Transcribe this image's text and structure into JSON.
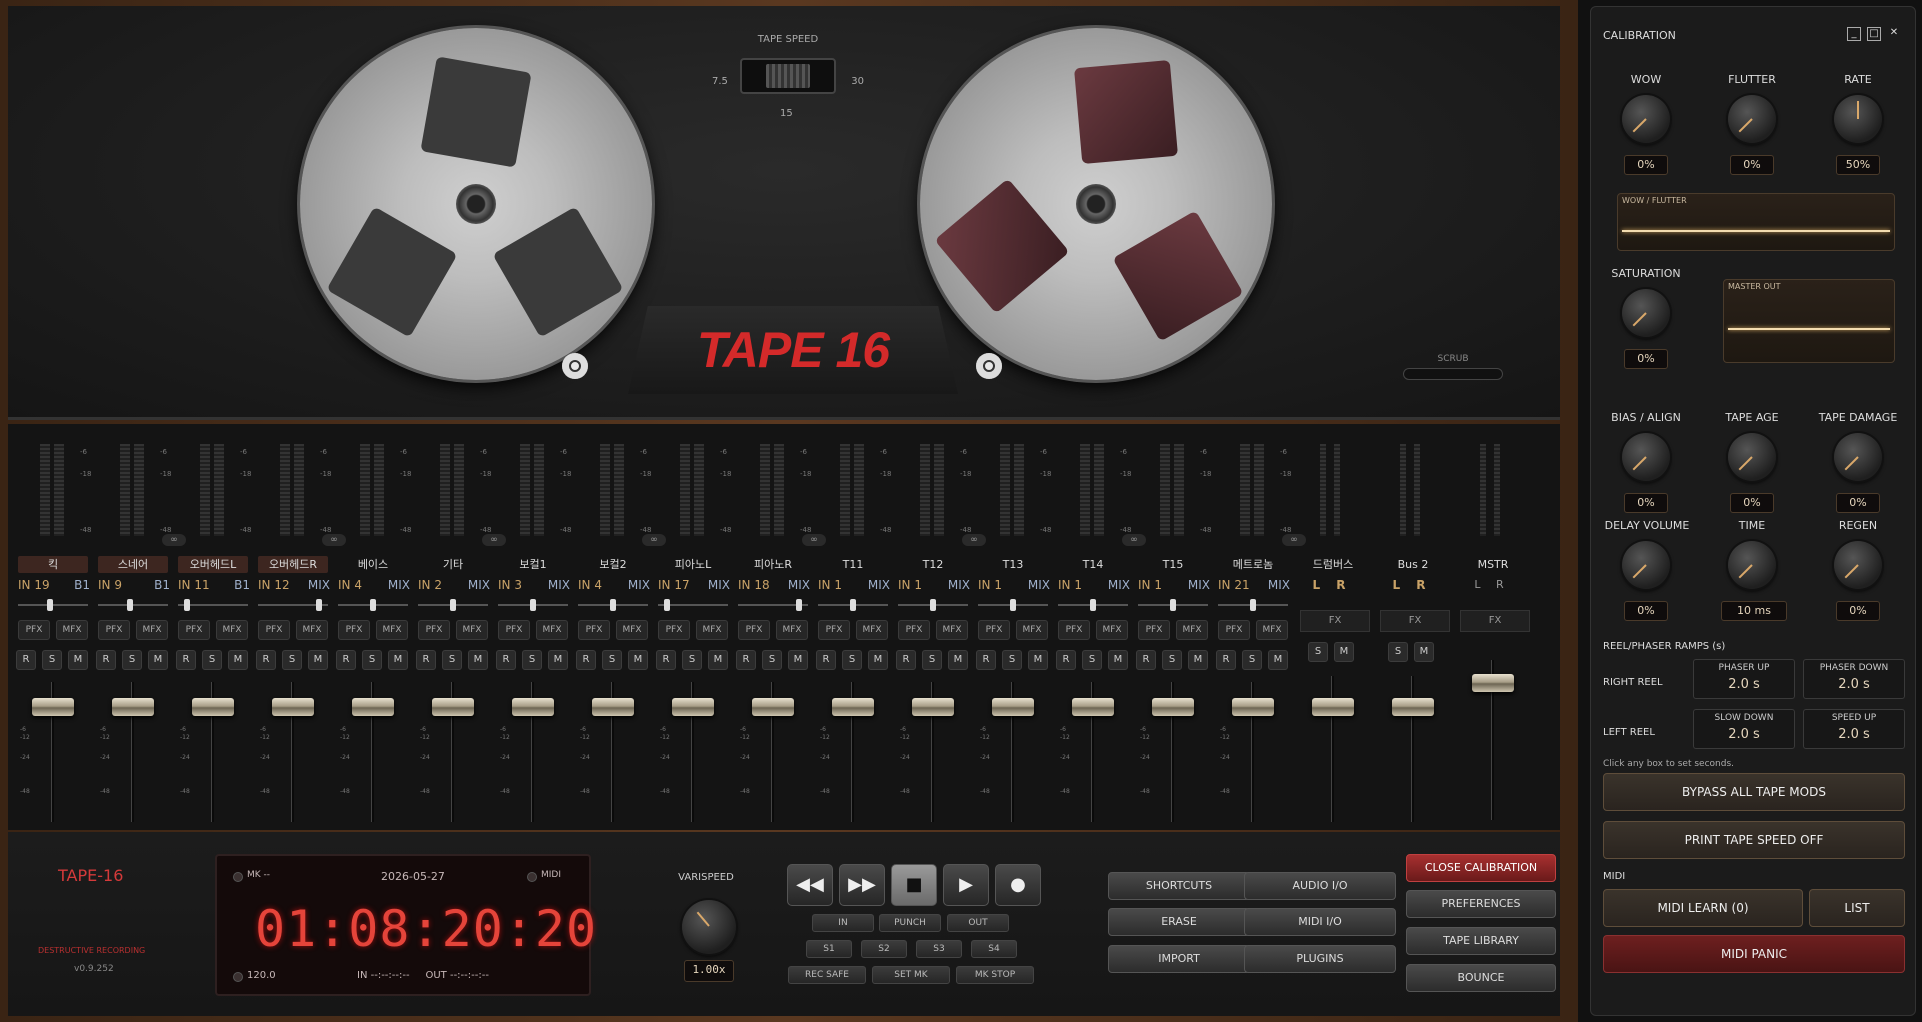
{
  "deck": {
    "logo": "TAPE 16",
    "tape_speed_label": "TAPE SPEED",
    "speed_low": "7.5",
    "speed_high": "30",
    "speed_mid": "15",
    "scrub_label": "SCRUB"
  },
  "channels": [
    {
      "name": "킥",
      "in": "IN 19",
      "route": "B1",
      "hl": true
    },
    {
      "name": "스네어",
      "in": "IN 9",
      "route": "B1",
      "hl": true
    },
    {
      "name": "오버헤드L",
      "in": "IN 11",
      "route": "B1",
      "hl": true
    },
    {
      "name": "오버헤드R",
      "in": "IN 12",
      "route": "MIX",
      "hl": true
    },
    {
      "name": "베이스",
      "in": "IN 4",
      "route": "MIX",
      "hl": false
    },
    {
      "name": "기타",
      "in": "IN 2",
      "route": "MIX",
      "hl": false
    },
    {
      "name": "보컬1",
      "in": "IN 3",
      "route": "MIX",
      "hl": false
    },
    {
      "name": "보컬2",
      "in": "IN 4",
      "route": "MIX",
      "hl": false
    },
    {
      "name": "피아노L",
      "in": "IN 17",
      "route": "MIX",
      "hl": false
    },
    {
      "name": "피아노R",
      "in": "IN 18",
      "route": "MIX",
      "hl": false
    },
    {
      "name": "T11",
      "in": "IN 1",
      "route": "MIX",
      "hl": false
    },
    {
      "name": "T12",
      "in": "IN 1",
      "route": "MIX",
      "hl": false
    },
    {
      "name": "T13",
      "in": "IN 1",
      "route": "MIX",
      "hl": false
    },
    {
      "name": "T14",
      "in": "IN 1",
      "route": "MIX",
      "hl": false
    },
    {
      "name": "T15",
      "in": "IN 1",
      "route": "MIX",
      "hl": false
    },
    {
      "name": "메트로놈",
      "in": "IN 21",
      "route": "MIX",
      "hl": false
    }
  ],
  "strip_labels": {
    "pfx": "PFX",
    "mfx": "MFX",
    "r": "R",
    "s": "S",
    "m": "M",
    "fx": "FX",
    "lr": "L R",
    "link": "∞",
    "m6": "-6",
    "m12": "-12",
    "m18": "-18",
    "m24": "-24",
    "m48": "-48"
  },
  "buses": [
    {
      "name": "드럼버스"
    },
    {
      "name": "Bus 2"
    },
    {
      "name": "MSTR"
    }
  ],
  "transport": {
    "brand": "TAPE-16",
    "mode": "DESTRUCTIVE RECORDING",
    "version": "v0.9.252",
    "mk": "MK --",
    "date": "2026-05-27",
    "midi": "MIDI",
    "timecode": "01:08:20:20",
    "bpm": "120.0",
    "in_out": "IN --:--:--:--     OUT --:--:--:--",
    "varispeed_label": "VARISPEED",
    "varispeed_value": "1.00x",
    "in": "IN",
    "punch": "PUNCH",
    "out": "OUT",
    "s1": "S1",
    "s2": "S2",
    "s3": "S3",
    "s4": "S4",
    "rec_safe": "REC SAFE",
    "set_mk": "SET MK",
    "mk_stop": "MK STOP",
    "rew": "◀◀",
    "ff": "▶▶",
    "stop": "■",
    "play": "▶",
    "rec": "●"
  },
  "buttons": {
    "shortcuts": "SHORTCUTS",
    "erase": "ERASE",
    "import": "IMPORT",
    "audio_io": "AUDIO I/O",
    "midi_io": "MIDI I/O",
    "plugins": "PLUGINS",
    "close_cal": "CLOSE CALIBRATION",
    "preferences": "PREFERENCES",
    "tape_library": "TAPE LIBRARY",
    "bounce": "BOUNCE"
  },
  "calibration": {
    "title": "CALIBRATION",
    "win_min": "_",
    "win_max": "□",
    "win_close": "✕",
    "wow": "WOW",
    "wow_v": "0%",
    "flutter": "FLUTTER",
    "flutter_v": "0%",
    "rate": "RATE",
    "rate_v": "50%",
    "wf_label": "WOW / FLUTTER",
    "saturation": "SATURATION",
    "saturation_v": "0%",
    "master_out": "MASTER OUT",
    "bias": "BIAS / ALIGN",
    "bias_v": "0%",
    "tape_age": "TAPE AGE",
    "tape_age_v": "0%",
    "tape_damage": "TAPE DAMAGE",
    "tape_damage_v": "0%",
    "delay_volume": "DELAY VOLUME",
    "delay_volume_v": "0%",
    "time": "TIME",
    "time_v": "10 ms",
    "regen": "REGEN",
    "regen_v": "0%",
    "ramps_title": "REEL/PHASER RAMPS (s)",
    "right_reel": "RIGHT REEL",
    "left_reel": "LEFT REEL",
    "phaser_up": "PHASER UP",
    "phaser_up_v": "2.0 s",
    "phaser_down": "PHASER DOWN",
    "phaser_down_v": "2.0 s",
    "slow_down": "SLOW DOWN",
    "slow_down_v": "2.0 s",
    "speed_up": "SPEED UP",
    "speed_up_v": "2.0 s",
    "hint": "Click any box to set seconds.",
    "bypass": "BYPASS ALL TAPE MODS",
    "print_speed": "PRINT TAPE SPEED OFF",
    "midi": "MIDI",
    "midi_learn": "MIDI LEARN (0)",
    "list": "LIST",
    "midi_panic": "MIDI PANIC"
  }
}
